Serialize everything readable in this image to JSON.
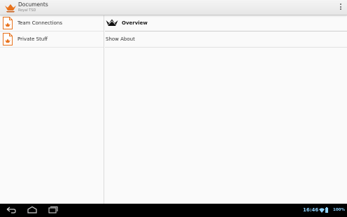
{
  "app": {
    "title": "Documents",
    "subtitle": "Royal TSD",
    "icon": "crown-logo-icon",
    "accent": "#e8731e"
  },
  "sidebar": {
    "items": [
      {
        "label": "Team Connections",
        "icon": "document-icon"
      },
      {
        "label": "Private Stuff",
        "icon": "document-icon"
      }
    ]
  },
  "detail": {
    "overview_label": "Overview",
    "items": [
      {
        "label": "Show About"
      }
    ]
  },
  "statusbar": {
    "time": "16:46",
    "battery": "100%",
    "time_color": "#8fd3ff"
  }
}
